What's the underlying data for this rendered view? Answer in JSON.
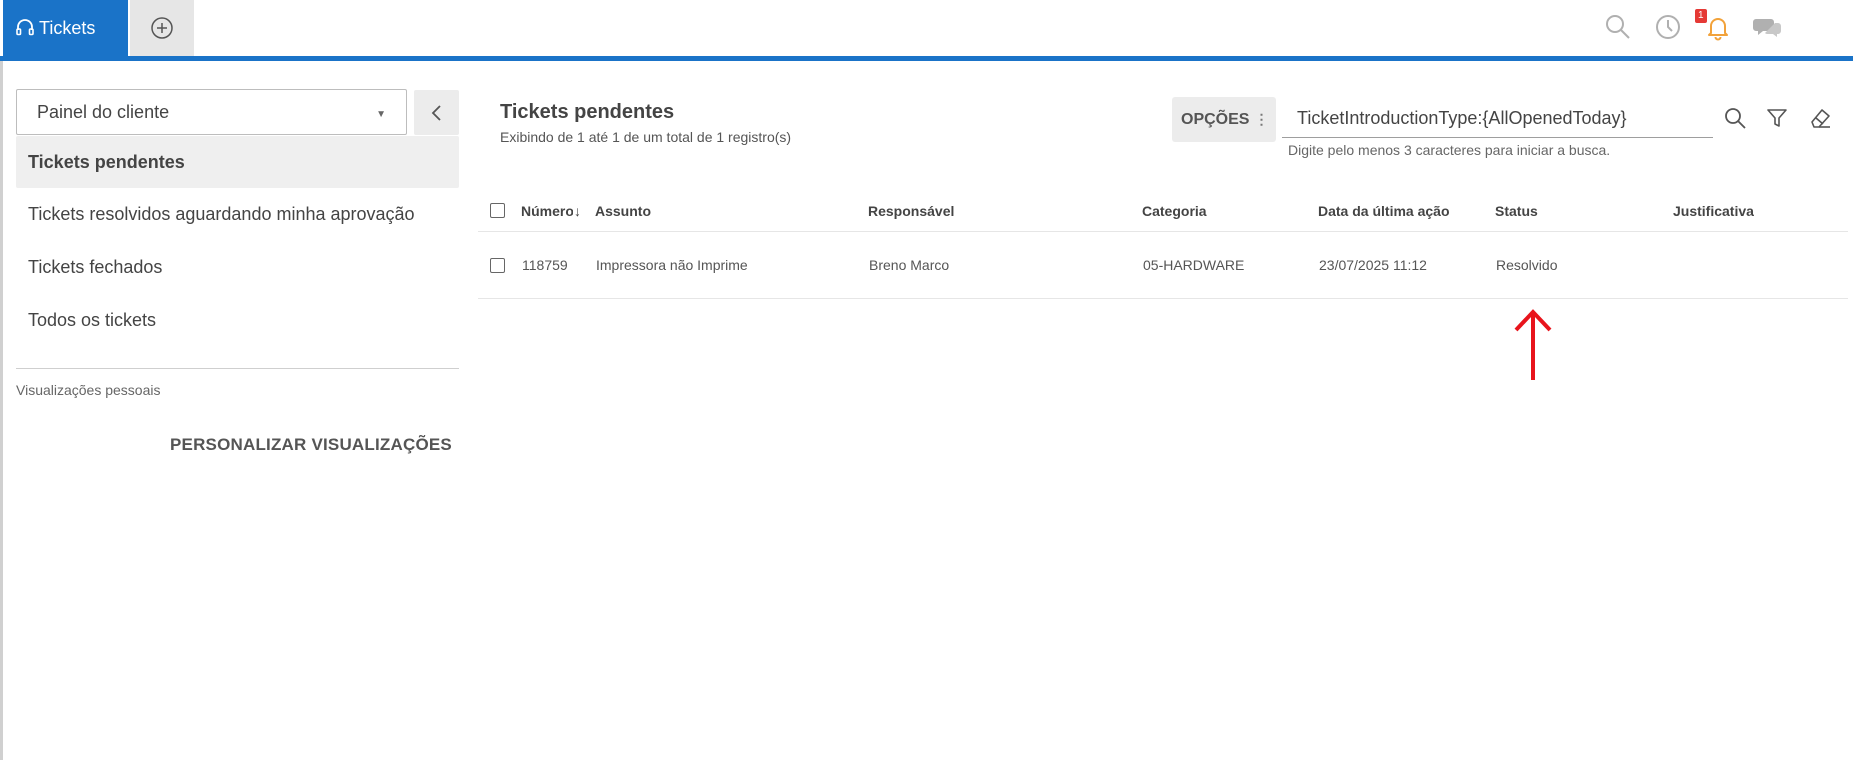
{
  "topbar": {
    "active_tab_label": "Tickets",
    "notification_count": "1",
    "brand_color": "#1a73c8",
    "icons": [
      "headset-icon",
      "plus-circle-icon",
      "search-icon",
      "history-icon",
      "bell-icon",
      "chat-icon"
    ]
  },
  "sidebar": {
    "panel_select_value": "Painel do cliente",
    "items": [
      {
        "label": "Tickets pendentes"
      },
      {
        "label": "Tickets resolvidos aguardando minha aprovação"
      },
      {
        "label": "Tickets fechados"
      },
      {
        "label": "Todos os tickets"
      }
    ],
    "personal_views_label": "Visualizações pessoais",
    "customize_label": "PERSONALIZAR VISUALIZAÇÕES"
  },
  "main": {
    "title": "Tickets pendentes",
    "subtitle": "Exibindo de 1 até 1 de um total de 1 registro(s)",
    "options_label": "OPÇÕES",
    "search_value": "TicketIntroductionType:{AllOpenedToday}",
    "search_hint": "Digite pelo menos 3 caracteres para iniciar a busca."
  },
  "table": {
    "columns": [
      "Número",
      "Assunto",
      "Responsável",
      "Categoria",
      "Data da última ação",
      "Status",
      "Justificativa"
    ],
    "rows": [
      {
        "numero": "118759",
        "assunto": "Impressora não Imprime",
        "responsavel": "Breno Marco",
        "categoria": "05-HARDWARE",
        "data": "23/07/2025 11:12",
        "status": "Resolvido",
        "justificativa": ""
      }
    ]
  },
  "annotation": {
    "color": "#e8141c",
    "icon": "red-arrow-up-icon"
  }
}
